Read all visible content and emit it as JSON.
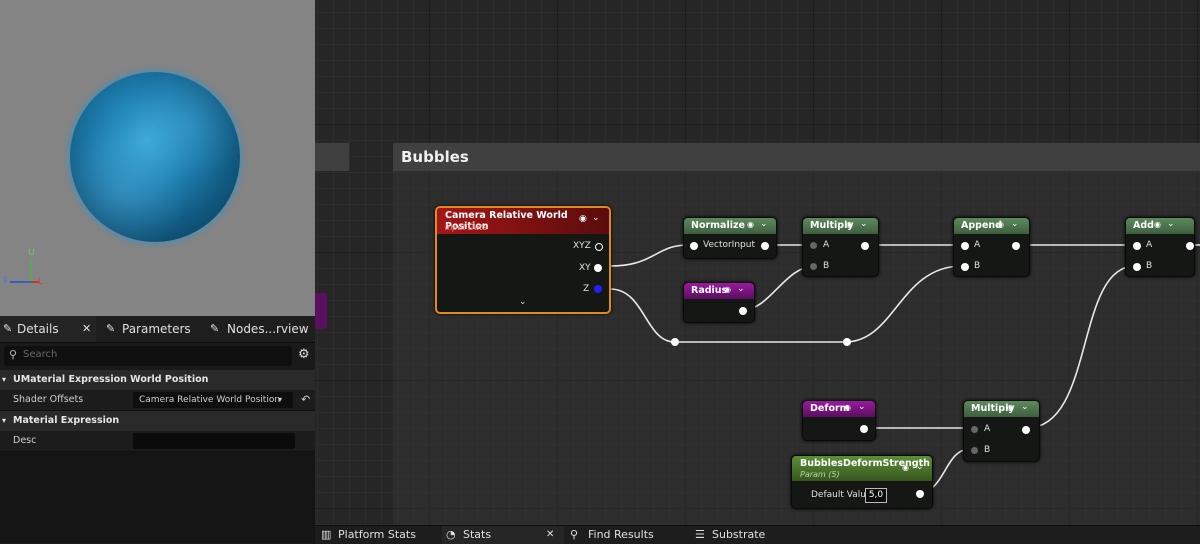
{
  "viewport": {
    "axis_labels": {
      "up": "U",
      "forward": "F",
      "left": "L"
    }
  },
  "details_panel": {
    "tabs": [
      {
        "label": "Details",
        "icon": "pencil-icon",
        "closable": true
      },
      {
        "label": "Parameters",
        "icon": "pencil-icon"
      },
      {
        "label": "Nodes...rview",
        "icon": "pencil-icon"
      }
    ],
    "search_placeholder": "Search",
    "sections": [
      {
        "title": "UMaterial Expression World Position",
        "rows": [
          {
            "label": "Shader Offsets",
            "value": "Camera Relative World Position (In"
          }
        ]
      },
      {
        "title": "Material Expression",
        "rows": [
          {
            "label": "Desc",
            "value": ""
          }
        ]
      }
    ]
  },
  "graph": {
    "comment_title": "Bubbles",
    "nodes": {
      "camera": {
        "title": "Camera Relative World Position",
        "subtitle": "Input Data",
        "outputs": [
          "XYZ",
          "XY",
          "Z"
        ]
      },
      "normalize": {
        "title": "Normalize",
        "input": "VectorInput"
      },
      "multiply1": {
        "title": "Multiply",
        "inputs": [
          "A",
          "B"
        ]
      },
      "append": {
        "title": "Append",
        "inputs": [
          "A",
          "B"
        ]
      },
      "add": {
        "title": "Add",
        "inputs": [
          "A",
          "B"
        ]
      },
      "radius": {
        "title": "Radius"
      },
      "deform": {
        "title": "Deform"
      },
      "multiply2": {
        "title": "Multiply",
        "inputs": [
          "A",
          "B"
        ]
      },
      "param": {
        "title": "BubblesDeformStrength",
        "subtitle": "Param (5)",
        "field_label": "Default Value",
        "field_value": "5,0"
      }
    },
    "colors": {
      "selected_border": "#e08a1e",
      "camera_head": "#8a1010",
      "z_pin": "#2020ff"
    }
  },
  "bottom_tabs": [
    {
      "label": "Platform Stats",
      "icon": "platform-icon"
    },
    {
      "label": "Stats",
      "icon": "stats-icon",
      "closable": true
    },
    {
      "label": "Find Results",
      "icon": "search-icon"
    },
    {
      "label": "Substrate",
      "icon": "list-icon"
    }
  ]
}
